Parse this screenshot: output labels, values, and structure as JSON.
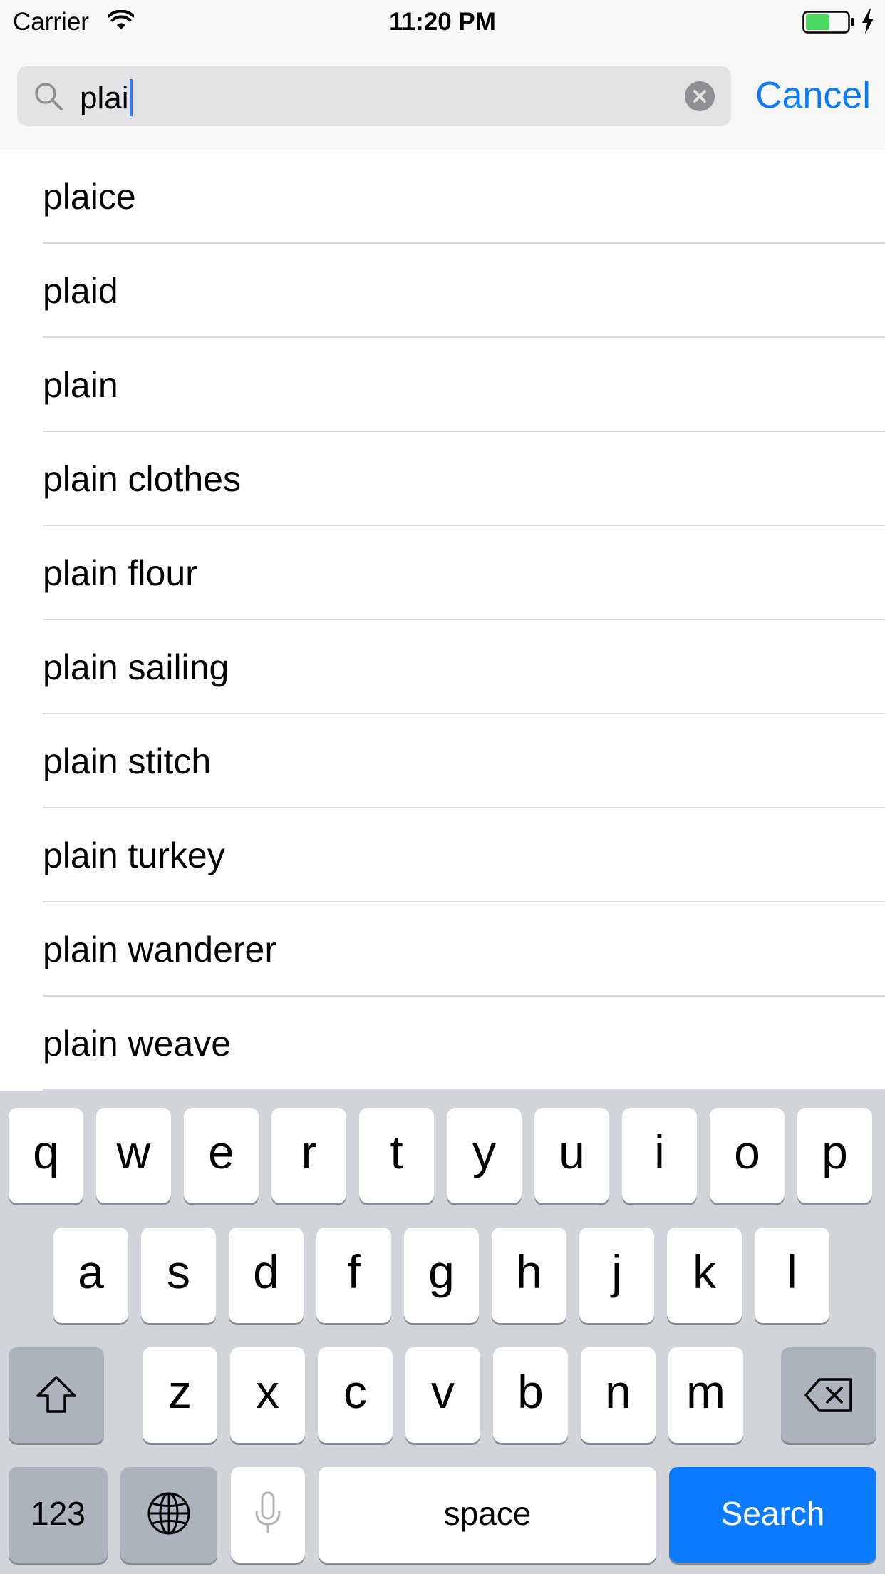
{
  "status_bar": {
    "carrier": "Carrier",
    "time": "11:20 PM",
    "battery_color": "#4cd964"
  },
  "search": {
    "query": "plai",
    "cancel_label": "Cancel",
    "accent_color": "#0a7aff"
  },
  "results": [
    "plaice",
    "plaid",
    "plain",
    "plain clothes",
    "plain flour",
    "plain sailing",
    "plain stitch",
    "plain turkey",
    "plain wanderer",
    "plain weave"
  ],
  "keyboard": {
    "row1": [
      "q",
      "w",
      "e",
      "r",
      "t",
      "y",
      "u",
      "i",
      "o",
      "p"
    ],
    "row2": [
      "a",
      "s",
      "d",
      "f",
      "g",
      "h",
      "j",
      "k",
      "l"
    ],
    "row3": [
      "z",
      "x",
      "c",
      "v",
      "b",
      "n",
      "m"
    ],
    "numbers_label": "123",
    "space_label": "space",
    "search_label": "Search",
    "icons": {
      "shift": "shift-icon",
      "delete": "delete-icon",
      "globe": "globe-icon",
      "mic": "microphone-icon"
    }
  }
}
